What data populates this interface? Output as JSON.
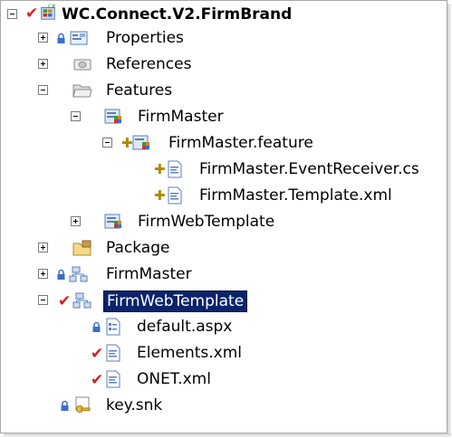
{
  "tree": {
    "root": {
      "label": "WC.Connect.V2.FirmBrand",
      "icon": "csharp-project-icon",
      "status": "checked-out"
    },
    "items": [
      {
        "label": "Properties",
        "icon": "properties-icon",
        "expander": "plus",
        "status": "locked"
      },
      {
        "label": "References",
        "icon": "references-icon",
        "expander": "plus"
      },
      {
        "label": "Features",
        "icon": "folder-open-icon",
        "expander": "minus"
      },
      {
        "label": "FirmMaster",
        "icon": "feature-icon",
        "expander": "minus"
      },
      {
        "label": "FirmMaster.feature",
        "icon": "feature-file-icon",
        "expander": "minus",
        "status": "added"
      },
      {
        "label": "FirmMaster.EventReceiver.cs",
        "icon": "cs-file-icon",
        "status": "added"
      },
      {
        "label": "FirmMaster.Template.xml",
        "icon": "xml-file-icon",
        "status": "added"
      },
      {
        "label": "FirmWebTemplate",
        "icon": "feature-icon",
        "expander": "plus"
      },
      {
        "label": "Package",
        "icon": "package-icon",
        "expander": "plus"
      },
      {
        "label": "FirmMaster",
        "icon": "module-icon",
        "expander": "plus",
        "status": "locked"
      },
      {
        "label": "FirmWebTemplate",
        "icon": "module-icon",
        "expander": "minus",
        "status": "checked-out",
        "selected": true
      },
      {
        "label": "default.aspx",
        "icon": "aspx-file-icon",
        "status": "locked"
      },
      {
        "label": "Elements.xml",
        "icon": "xml-file-icon",
        "status": "checked-out"
      },
      {
        "label": "ONET.xml",
        "icon": "xml-file-icon",
        "status": "checked-out"
      },
      {
        "label": "key.snk",
        "icon": "key-file-icon",
        "status": "locked"
      }
    ]
  },
  "colors": {
    "selection_bg": "#0a246a",
    "checkout_mark": "#d42020",
    "lock": "#3b6fc4",
    "add_mark": "#b08800"
  }
}
